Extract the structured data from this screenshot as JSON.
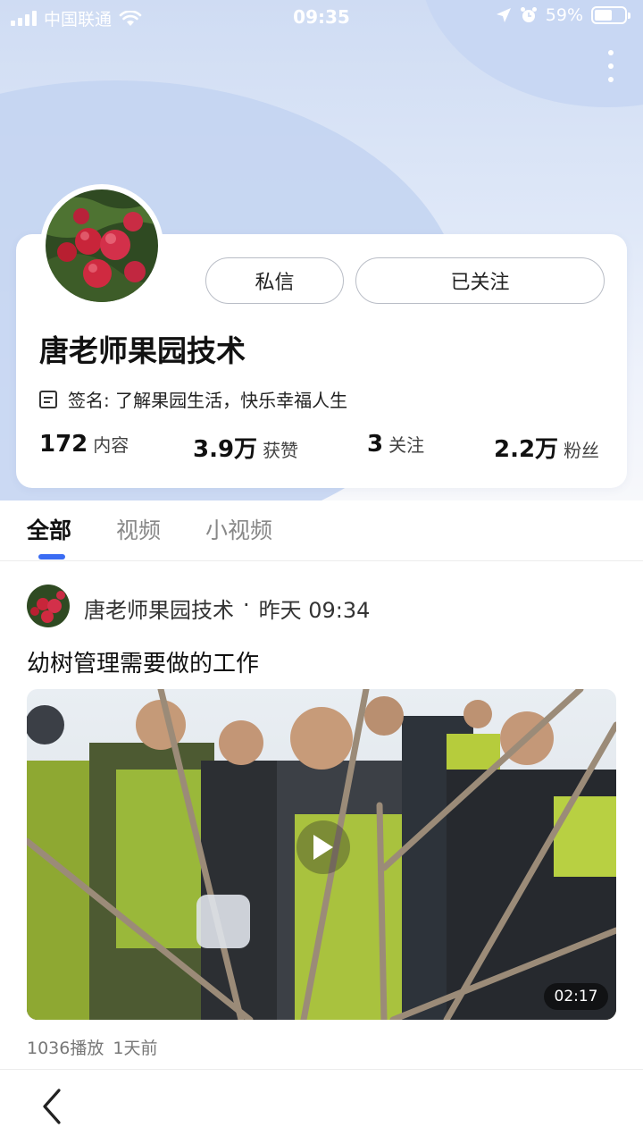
{
  "status_bar": {
    "carrier": "中国联通",
    "time": "09:35",
    "battery_text": "59%",
    "battery_level": 0.59
  },
  "profile": {
    "name": "唐老师果园技术",
    "signature": "签名: 了解果园生活，快乐幸福人生",
    "buttons": {
      "message": "私信",
      "follow": "已关注"
    },
    "stats": [
      {
        "value": "172",
        "label": "内容"
      },
      {
        "value": "3.9万",
        "label": "获赞"
      },
      {
        "value": "3",
        "label": "关注"
      },
      {
        "value": "2.2万",
        "label": "粉丝"
      }
    ]
  },
  "tabs": [
    {
      "label": "全部",
      "active": true
    },
    {
      "label": "视频",
      "active": false
    },
    {
      "label": "小视频",
      "active": false
    }
  ],
  "post": {
    "author": "唐老师果园技术",
    "separator": "·",
    "time": "昨天 09:34",
    "title": "幼树管理需要做的工作",
    "duration": "02:17",
    "plays": "1036播放",
    "age": "1天前"
  },
  "icons": {
    "more": "more-vertical-icon",
    "back": "chevron-left-icon",
    "play": "play-icon",
    "signature": "note-icon"
  },
  "colors": {
    "accent": "#3a6cf3",
    "hero_bg": "#cfdcf3"
  }
}
